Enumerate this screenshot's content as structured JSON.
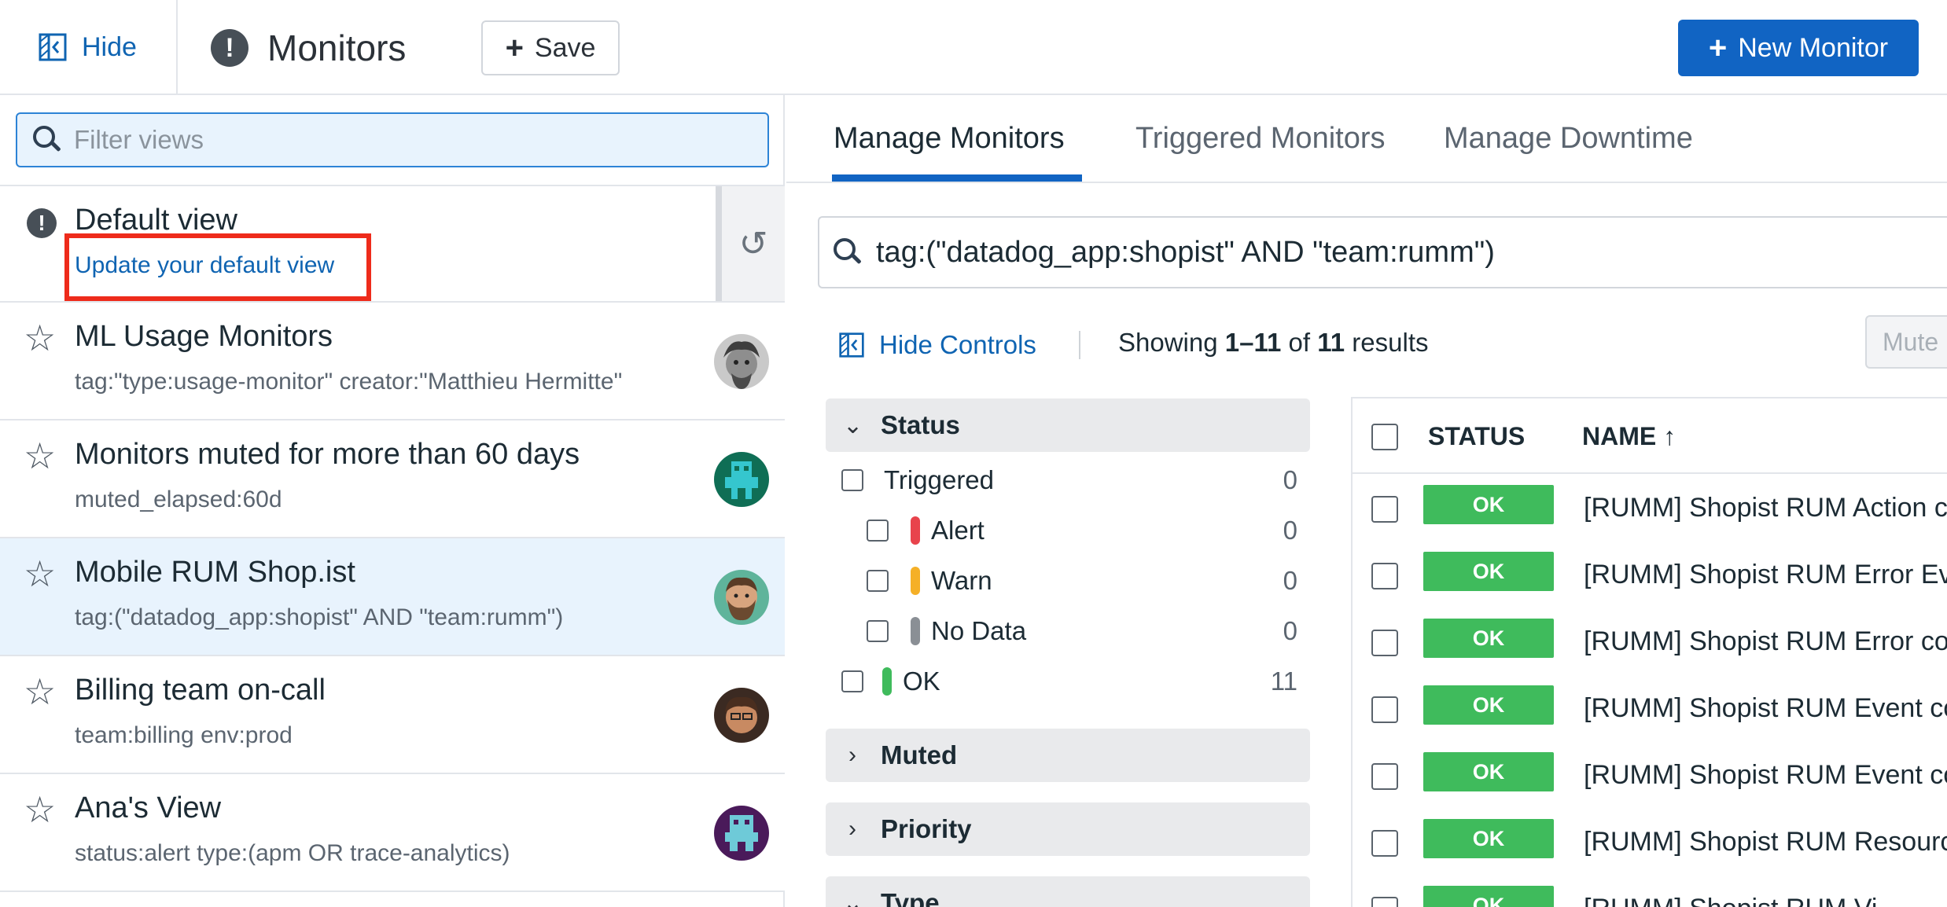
{
  "header": {
    "hide_label": "Hide",
    "title": "Monitors",
    "save_label": "Save",
    "new_monitor_label": "New Monitor"
  },
  "sidebar": {
    "filter_placeholder": "Filter views",
    "default_view": {
      "title": "Default view",
      "link": "Update your default view"
    },
    "views": [
      {
        "name": "ML Usage Monitors",
        "query": "tag:\"type:usage-monitor\" creator:\"Matthieu Hermitte\"",
        "avatar": "avatar-matthieu"
      },
      {
        "name": "Monitors muted for more than 60 days",
        "query": "muted_elapsed:60d",
        "avatar": "avatar-green-robot"
      },
      {
        "name": "Mobile RUM Shop.ist",
        "query": "tag:(\"datadog_app:shopist\" AND \"team:rumm\")",
        "avatar": "avatar-bearded-man",
        "active": true
      },
      {
        "name": "Billing team on-call",
        "query": "team:billing env:prod",
        "avatar": "avatar-glasses-man"
      },
      {
        "name": "Ana's View",
        "query": "status:alert type:(apm OR trace-analytics)",
        "avatar": "avatar-purple-robot"
      }
    ]
  },
  "main": {
    "tabs": [
      "Manage Monitors",
      "Triggered Monitors",
      "Manage Downtime"
    ],
    "active_tab": 0,
    "query": "tag:(\"datadog_app:shopist\" AND \"team:rumm\")",
    "hide_controls_label": "Hide Controls",
    "showing": {
      "prefix": "Showing",
      "range": "1–11",
      "of": "of",
      "total": "11",
      "suffix": "results"
    },
    "mute_label": "Mute",
    "facets": {
      "status": {
        "label": "Status",
        "items": [
          {
            "label": "Triggered",
            "count": "0",
            "indent": false,
            "color": null
          },
          {
            "label": "Alert",
            "count": "0",
            "indent": true,
            "color": "#e8434c"
          },
          {
            "label": "Warn",
            "count": "0",
            "indent": true,
            "color": "#f5b027"
          },
          {
            "label": "No Data",
            "count": "0",
            "indent": true,
            "color": "#8a8f95"
          },
          {
            "label": "OK",
            "count": "11",
            "indent": false,
            "color": "#3fbb5c"
          }
        ]
      },
      "muted": "Muted",
      "priority": "Priority",
      "type": "Type"
    },
    "table": {
      "headers": {
        "status": "STATUS",
        "name": "NAME ↑"
      },
      "rows": [
        {
          "status": "OK",
          "name": "[RUMM] Shopist RUM Action co"
        },
        {
          "status": "OK",
          "name": "[RUMM] Shopist RUM Error Eve"
        },
        {
          "status": "OK",
          "name": "[RUMM] Shopist RUM Error cou"
        },
        {
          "status": "OK",
          "name": "[RUMM] Shopist RUM Event co"
        },
        {
          "status": "OK",
          "name": "[RUMM] Shopist RUM Event co"
        },
        {
          "status": "OK",
          "name": "[RUMM] Shopist RUM Resource"
        },
        {
          "status": "OK",
          "name": "[RUMM] Shopist RUM Vi"
        }
      ]
    }
  },
  "colors": {
    "accent": "#1164c3",
    "link": "#0f64b2",
    "ok": "#3fbb5c",
    "highlight": "#ee2b1b"
  }
}
